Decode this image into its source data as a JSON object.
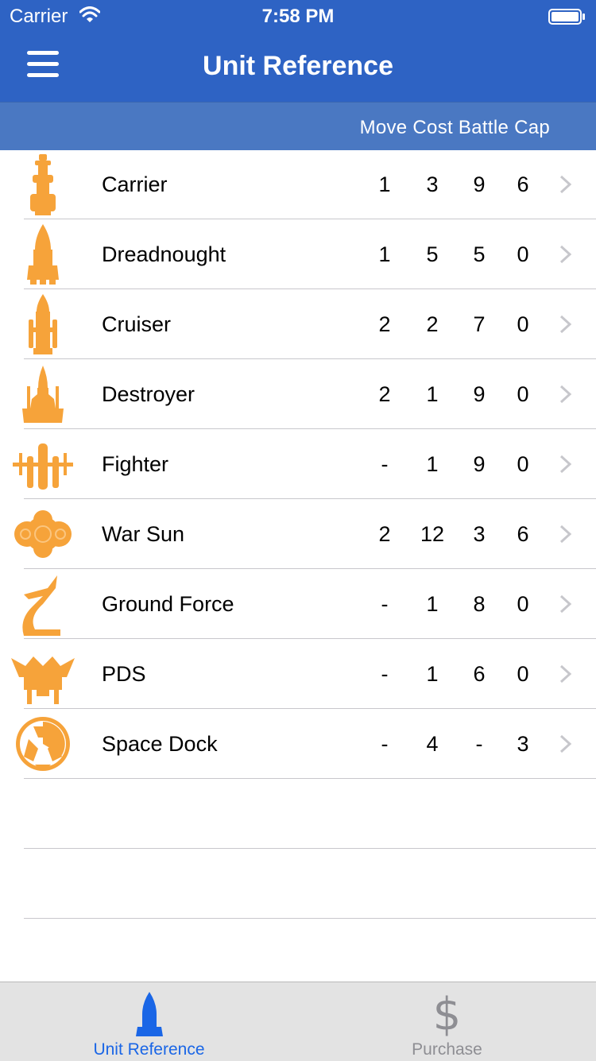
{
  "status_bar": {
    "carrier": "Carrier",
    "time": "7:58 PM"
  },
  "nav": {
    "title": "Unit Reference"
  },
  "header": {
    "columns": "Move Cost Battle Cap"
  },
  "units": [
    {
      "name": "Carrier",
      "move": "1",
      "cost": "3",
      "battle": "9",
      "cap": "6",
      "icon": "carrier-icon"
    },
    {
      "name": "Dreadnought",
      "move": "1",
      "cost": "5",
      "battle": "5",
      "cap": "0",
      "icon": "dreadnought-icon"
    },
    {
      "name": "Cruiser",
      "move": "2",
      "cost": "2",
      "battle": "7",
      "cap": "0",
      "icon": "cruiser-icon"
    },
    {
      "name": "Destroyer",
      "move": "2",
      "cost": "1",
      "battle": "9",
      "cap": "0",
      "icon": "destroyer-icon"
    },
    {
      "name": "Fighter",
      "move": "-",
      "cost": "1",
      "battle": "9",
      "cap": "0",
      "icon": "fighter-icon"
    },
    {
      "name": "War Sun",
      "move": "2",
      "cost": "12",
      "battle": "3",
      "cap": "6",
      "icon": "war-sun-icon"
    },
    {
      "name": "Ground Force",
      "move": "-",
      "cost": "1",
      "battle": "8",
      "cap": "0",
      "icon": "ground-force-icon"
    },
    {
      "name": "PDS",
      "move": "-",
      "cost": "1",
      "battle": "6",
      "cap": "0",
      "icon": "pds-icon"
    },
    {
      "name": "Space Dock",
      "move": "-",
      "cost": "4",
      "battle": "-",
      "cap": "3",
      "icon": "space-dock-icon"
    }
  ],
  "tabs": [
    {
      "label": "Unit Reference",
      "icon": "rocket-icon",
      "selected": true
    },
    {
      "label": "Purchase",
      "icon": "dollar-icon",
      "selected": false
    }
  ],
  "colors": {
    "nav_blue": "#2E63C4",
    "header_blue": "#4A78C2",
    "icon_orange": "#F6A33A",
    "tab_active": "#1A66E6",
    "tab_inactive": "#8E8E93"
  }
}
